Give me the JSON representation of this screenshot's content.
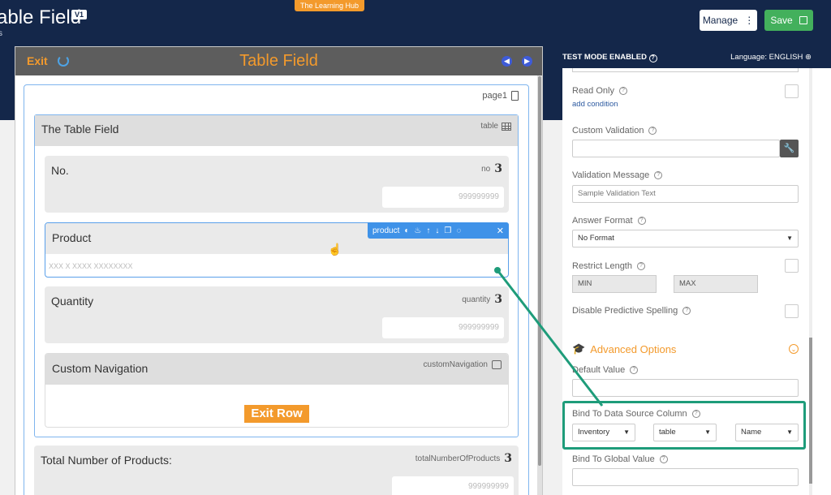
{
  "app": {
    "title": "able Field",
    "version": "V1",
    "subtitle": "s",
    "hub_badge": "The Learning Hub",
    "manage_label": "Manage",
    "save_label": "Save"
  },
  "form": {
    "exit_label": "Exit",
    "title": "Table Field",
    "page_label": "page1",
    "table_title": "The Table Field",
    "table_tag": "table",
    "fields": {
      "no": {
        "label": "No.",
        "tag": "no",
        "placeholder": "999999999"
      },
      "product": {
        "label": "Product",
        "tag": "product",
        "placeholder": "XXX X XXXX XXXXXXXX"
      },
      "quantity": {
        "label": "Quantity",
        "tag": "quantity",
        "placeholder": "999999999"
      },
      "custom_nav": {
        "label": "Custom Navigation",
        "tag": "customNavigation",
        "button": "Exit Row"
      },
      "total": {
        "label": "Total Number of Products:",
        "tag": "totalNumberOfProducts",
        "placeholder": "999999999"
      }
    },
    "number_glyph": "3"
  },
  "settings": {
    "test_mode": "TEST MODE ENABLED",
    "language": "Language: ENGLISH",
    "read_only": "Read Only",
    "add_condition": "add condition",
    "custom_validation": "Custom Validation",
    "validation_message": "Validation Message",
    "validation_message_value": "Sample Validation Text",
    "answer_format": "Answer Format",
    "answer_format_value": "No Format",
    "restrict_length": "Restrict Length",
    "min_label": "MIN",
    "max_label": "MAX",
    "disable_predictive": "Disable Predictive Spelling",
    "advanced_options": "Advanced Options",
    "default_value": "Default Value",
    "bind_column": "Bind To Data Source Column",
    "bind_source": "Inventory",
    "bind_table": "table",
    "bind_field": "Name",
    "bind_global": "Bind To Global Value"
  },
  "colors": {
    "header_bg": "#14274a",
    "accent_orange": "#f39a2c",
    "highlight_green": "#1e9c7a",
    "save_green": "#43b05c",
    "selection_blue": "#3f92e8"
  }
}
